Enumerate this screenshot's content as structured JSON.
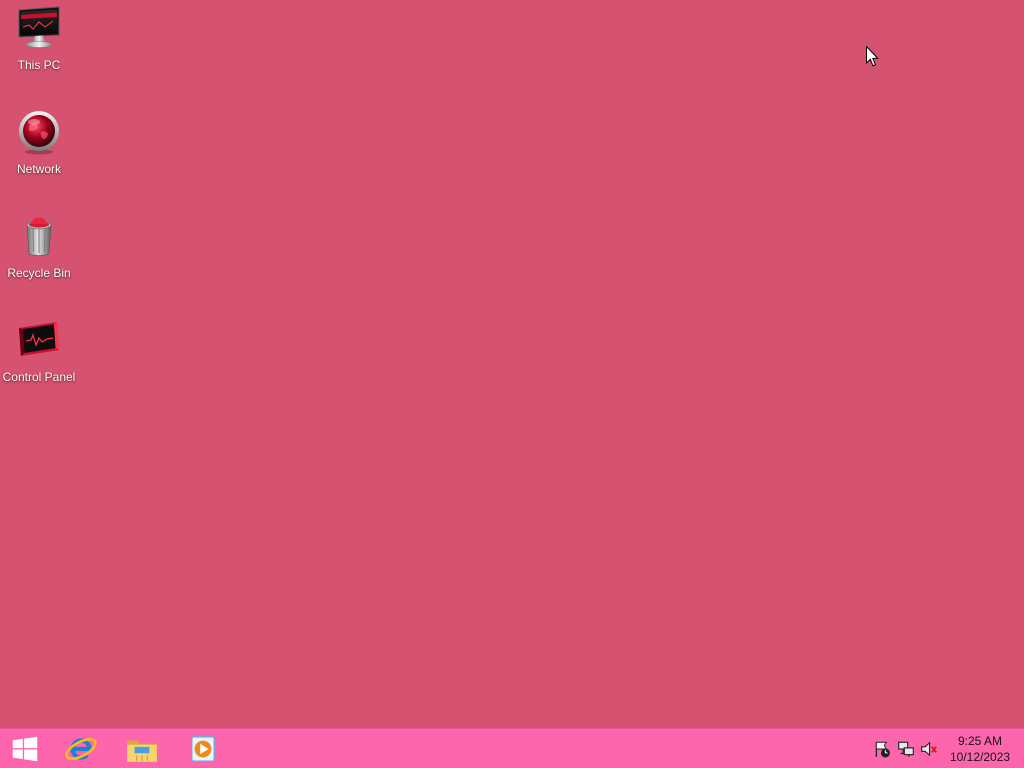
{
  "desktop": {
    "background_color": "#D55270",
    "icons": [
      {
        "label": "This PC",
        "icon": "this-pc-icon"
      },
      {
        "label": "Network",
        "icon": "network-icon"
      },
      {
        "label": "Recycle Bin",
        "icon": "recycle-bin-icon"
      },
      {
        "label": "Control Panel",
        "icon": "control-panel-icon"
      }
    ]
  },
  "taskbar": {
    "color": "#FD66AD",
    "start_button": {
      "icon": "windows-logo-icon"
    },
    "pinned_apps": [
      {
        "icon": "internet-explorer-icon"
      },
      {
        "icon": "file-explorer-icon"
      },
      {
        "icon": "windows-media-player-icon"
      }
    ],
    "tray": {
      "icons": [
        "action-center-icon",
        "network-status-icon",
        "volume-muted-icon"
      ],
      "time": "9:25 AM",
      "date": "10/12/2023"
    }
  },
  "cursor": {
    "icon": "mouse-pointer-icon"
  }
}
